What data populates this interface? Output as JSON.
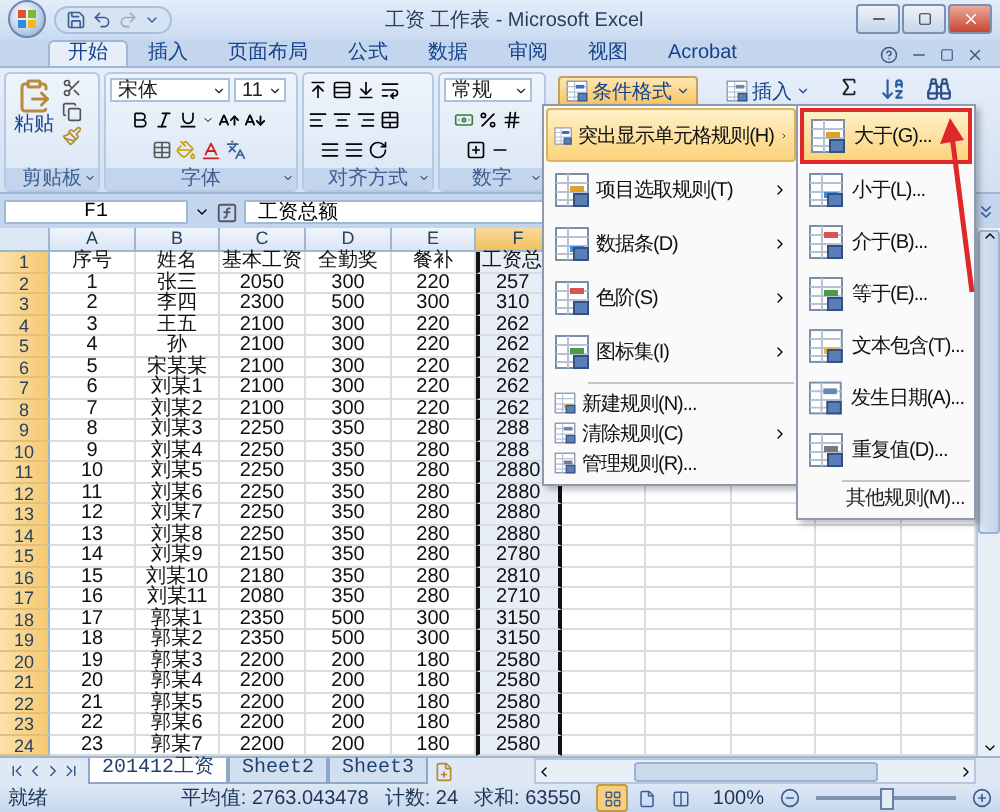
{
  "window": {
    "title": "工资 工作表 - Microsoft Excel"
  },
  "tabs": [
    {
      "label": "开始",
      "selected": true
    },
    {
      "label": "插入",
      "selected": false
    },
    {
      "label": "页面布局",
      "selected": false
    },
    {
      "label": "公式",
      "selected": false
    },
    {
      "label": "数据",
      "selected": false
    },
    {
      "label": "审阅",
      "selected": false
    },
    {
      "label": "视图",
      "selected": false
    },
    {
      "label": "Acrobat",
      "selected": false
    }
  ],
  "ribbon": {
    "paste": "粘贴",
    "font_name": "宋体",
    "font_size": "11",
    "number_format": "常规",
    "conditional_formatting": "条件格式",
    "insert": "插入",
    "groups": [
      "剪贴板",
      "字体",
      "对齐方式",
      "数字"
    ]
  },
  "formula_bar": {
    "name_box": "F1",
    "formula": "工资总额"
  },
  "columns": [
    {
      "label": "A",
      "selected": false
    },
    {
      "label": "B",
      "selected": false
    },
    {
      "label": "C",
      "selected": false
    },
    {
      "label": "D",
      "selected": false
    },
    {
      "label": "E",
      "selected": false
    },
    {
      "label": "F",
      "selected": true
    }
  ],
  "rows": [
    {
      "header": "1",
      "cells": [
        "序号",
        "姓名",
        "基本工资",
        "全勤奖",
        "餐补",
        "工资总"
      ]
    },
    {
      "header": "2",
      "cells": [
        "1",
        "张三",
        "2050",
        "300",
        "220",
        "257"
      ]
    },
    {
      "header": "3",
      "cells": [
        "2",
        "李四",
        "2300",
        "500",
        "300",
        "310"
      ]
    },
    {
      "header": "4",
      "cells": [
        "3",
        "王五",
        "2100",
        "300",
        "220",
        "262"
      ]
    },
    {
      "header": "5",
      "cells": [
        "4",
        "孙",
        "2100",
        "300",
        "220",
        "262"
      ]
    },
    {
      "header": "6",
      "cells": [
        "5",
        "宋某某",
        "2100",
        "300",
        "220",
        "262"
      ]
    },
    {
      "header": "7",
      "cells": [
        "6",
        "刘某1",
        "2100",
        "300",
        "220",
        "262"
      ]
    },
    {
      "header": "8",
      "cells": [
        "7",
        "刘某2",
        "2100",
        "300",
        "220",
        "262"
      ]
    },
    {
      "header": "9",
      "cells": [
        "8",
        "刘某3",
        "2250",
        "350",
        "280",
        "288"
      ]
    },
    {
      "header": "10",
      "cells": [
        "9",
        "刘某4",
        "2250",
        "350",
        "280",
        "288"
      ]
    },
    {
      "header": "11",
      "cells": [
        "10",
        "刘某5",
        "2250",
        "350",
        "280",
        "2880"
      ]
    },
    {
      "header": "12",
      "cells": [
        "11",
        "刘某6",
        "2250",
        "350",
        "280",
        "2880"
      ]
    },
    {
      "header": "13",
      "cells": [
        "12",
        "刘某7",
        "2250",
        "350",
        "280",
        "2880"
      ]
    },
    {
      "header": "14",
      "cells": [
        "13",
        "刘某8",
        "2250",
        "350",
        "280",
        "2880"
      ]
    },
    {
      "header": "15",
      "cells": [
        "14",
        "刘某9",
        "2150",
        "350",
        "280",
        "2780"
      ]
    },
    {
      "header": "16",
      "cells": [
        "15",
        "刘某10",
        "2180",
        "350",
        "280",
        "2810"
      ]
    },
    {
      "header": "17",
      "cells": [
        "16",
        "刘某11",
        "2080",
        "350",
        "280",
        "2710"
      ]
    },
    {
      "header": "18",
      "cells": [
        "17",
        "郭某1",
        "2350",
        "500",
        "300",
        "3150"
      ]
    },
    {
      "header": "19",
      "cells": [
        "18",
        "郭某2",
        "2350",
        "500",
        "300",
        "3150"
      ]
    },
    {
      "header": "20",
      "cells": [
        "19",
        "郭某3",
        "2200",
        "200",
        "180",
        "2580"
      ]
    },
    {
      "header": "21",
      "cells": [
        "20",
        "郭某4",
        "2200",
        "200",
        "180",
        "2580"
      ]
    },
    {
      "header": "22",
      "cells": [
        "21",
        "郭某5",
        "2200",
        "200",
        "180",
        "2580"
      ]
    },
    {
      "header": "23",
      "cells": [
        "22",
        "郭某6",
        "2200",
        "200",
        "180",
        "2580"
      ]
    },
    {
      "header": "24",
      "cells": [
        "23",
        "郭某7",
        "2200",
        "200",
        "180",
        "2580"
      ]
    }
  ],
  "conditional_menu": {
    "items": [
      {
        "label": "突出显示单元格规则(H)",
        "kind": "large",
        "selected": true,
        "submenu": true
      },
      {
        "label": "项目选取规则(T)",
        "kind": "large",
        "selected": false,
        "submenu": true
      },
      {
        "label": "数据条(D)",
        "kind": "large",
        "selected": false,
        "submenu": true
      },
      {
        "label": "色阶(S)",
        "kind": "large",
        "selected": false,
        "submenu": true
      },
      {
        "label": "图标集(I)",
        "kind": "large",
        "selected": false,
        "submenu": true
      },
      {
        "label": "新建规则(N)...",
        "kind": "small",
        "selected": false,
        "submenu": false
      },
      {
        "label": "清除规则(C)",
        "kind": "small",
        "selected": false,
        "submenu": true
      },
      {
        "label": "管理规则(R)...",
        "kind": "small",
        "selected": false,
        "submenu": false
      }
    ]
  },
  "submenu": {
    "items": [
      {
        "label": "大于(G)...",
        "selected": true
      },
      {
        "label": "小于(L)...",
        "selected": false
      },
      {
        "label": "介于(B)...",
        "selected": false
      },
      {
        "label": "等于(E)...",
        "selected": false
      },
      {
        "label": "文本包含(T)...",
        "selected": false
      },
      {
        "label": "发生日期(A)...",
        "selected": false
      },
      {
        "label": "重复值(D)...",
        "selected": false
      }
    ],
    "footer": "其他规则(M)..."
  },
  "sheet_tabs": [
    {
      "label": "201412工资",
      "selected": true
    },
    {
      "label": "Sheet2",
      "selected": false
    },
    {
      "label": "Sheet3",
      "selected": false
    }
  ],
  "status_bar": {
    "ready": "就绪",
    "average": "平均值: 2763.043478",
    "count": "计数: 24",
    "sum": "求和: 63550",
    "zoom": "100%",
    "view_buttons": [
      {
        "selected": true
      },
      {
        "selected": false
      },
      {
        "selected": false
      }
    ]
  }
}
